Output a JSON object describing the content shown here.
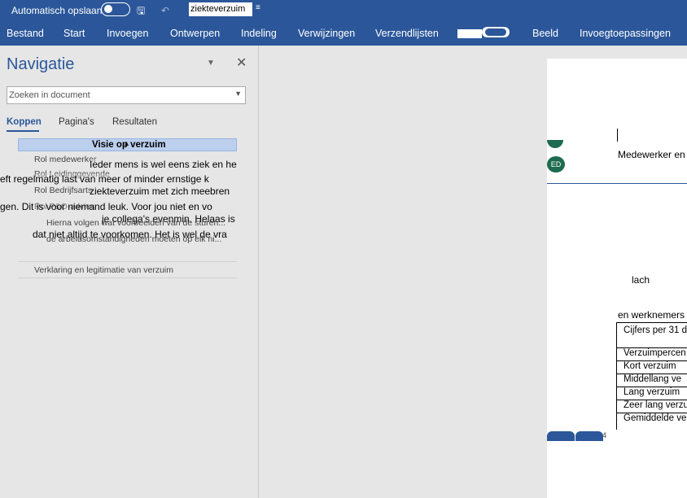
{
  "titlebar": {
    "autosave_label": "Automatisch opslaan",
    "doc_title": "ziekteverzuim"
  },
  "ribbon": {
    "tabs": [
      "Bestand",
      "Start",
      "Invoegen",
      "Ontwerpen",
      "Indeling",
      "Verwijzingen",
      "Verzendlijsten",
      "Beeld",
      "Invoegtoepassingen"
    ]
  },
  "nav": {
    "title": "Navigatie",
    "search_placeholder": "Zoeken in document",
    "tabs": [
      "Koppen",
      "Pagina's",
      "Resultaten"
    ],
    "selected_heading": "Visie op verzuim",
    "items": [
      "Rol medewerker",
      "Rol Leidinggevende",
      "Rol Bedrijfsarts",
      "Rol P&O-advies",
      "Hierna volgen wat voorbeelden van de sturen...",
      "de arbeidsomstandigheden moeten op elk ni...",
      "Verklaring en legitimatie van verzuim"
    ],
    "doc_overlay": [
      "Ieder mens is wel eens ziek en he",
      "eft regelmatig last van meer of minder ernstige k",
      "ziekteverzuim met zich meebren",
      "gen. Dit is voor niemand leuk. Voor jou niet en vo",
      "je collega's evenmin. Helaas is",
      "dat niet altijd te voorkomen. Het is wel de vra"
    ]
  },
  "page": {
    "avatar_initials": "ED",
    "line_medewerker": "Medewerker en",
    "line_lach": "lach",
    "line_werknemers": "en werknemers",
    "table_rows": [
      "Cijfers per 31 d",
      "Verzuimpercen",
      "Kort verzuim",
      "Middellang ve",
      "Lang verzuim",
      "Zeer lang verzu",
      "Gemiddelde ve"
    ],
    "page_number": "4"
  },
  "colors": {
    "brand": "#2b579a",
    "presence": "#1e6b4f"
  }
}
